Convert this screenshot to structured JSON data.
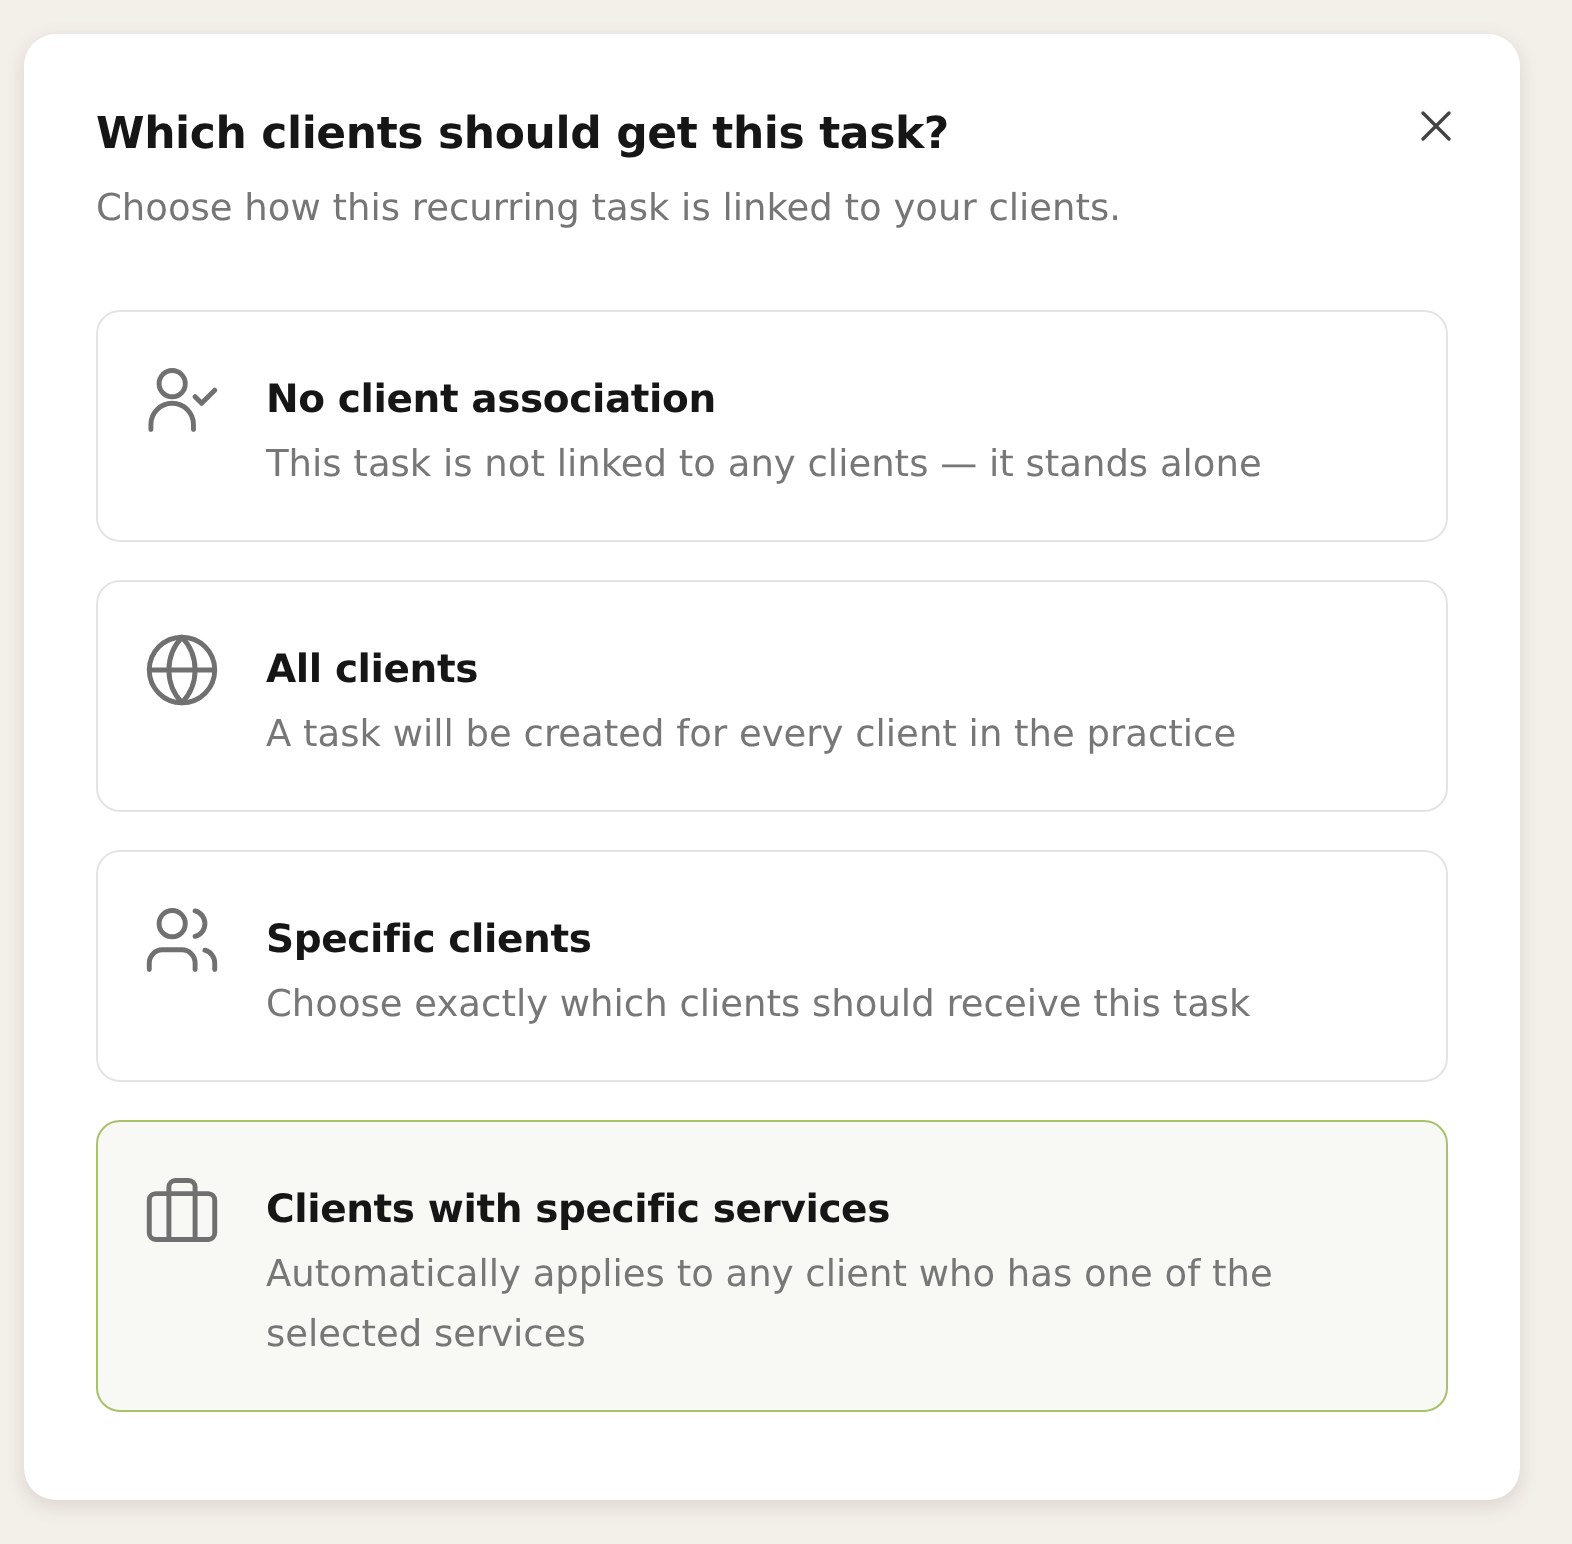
{
  "dialog": {
    "title": "Which clients should get this task?",
    "subtitle": "Choose how this recurring task is linked to your clients."
  },
  "options": [
    {
      "kind": "unlinked",
      "title": "No client association",
      "description": "This task is not linked to any clients — it stands alone",
      "selected": false
    },
    {
      "kind": "all",
      "title": "All clients",
      "description": "A task will be created for every client in the practice",
      "selected": false
    },
    {
      "kind": "specific",
      "title": "Specific clients",
      "description": "Choose exactly which clients should receive this task",
      "selected": false
    },
    {
      "kind": "services",
      "title": "Clients with specific services",
      "description": "Automatically applies to any client who has one of the selected services",
      "selected": true
    }
  ]
}
